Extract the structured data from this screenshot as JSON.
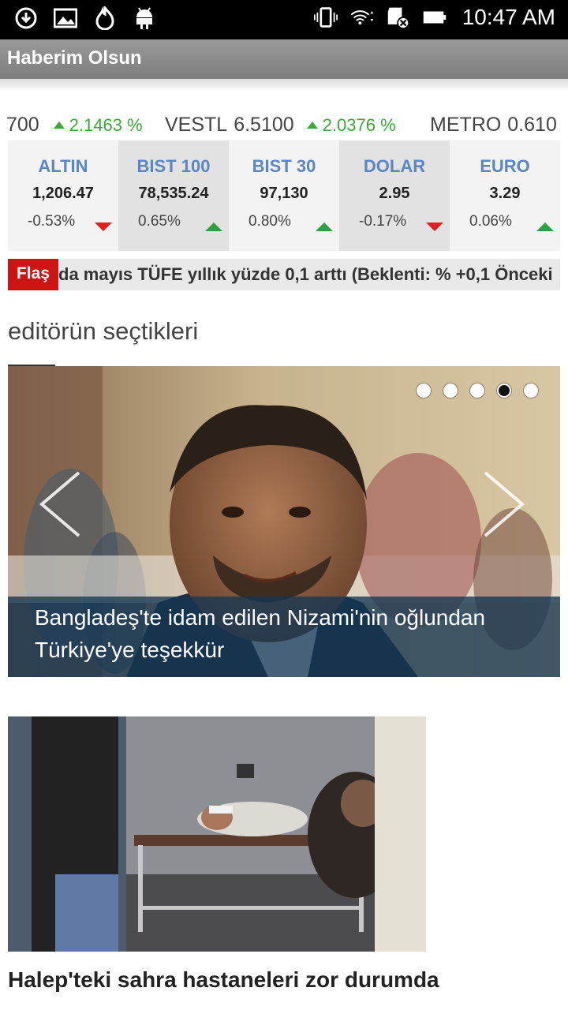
{
  "status_bar": {
    "time": "10:47 AM",
    "left_icons": [
      "download-icon",
      "image-icon",
      "flame-icon",
      "android-icon"
    ],
    "right_icons": [
      "vibrate-icon",
      "wifi-icon",
      "sd-card-icon",
      "battery-icon"
    ]
  },
  "app": {
    "title": "Haberim Olsun"
  },
  "ticker": {
    "items": [
      {
        "name": "",
        "price": "700",
        "change": "2.1463 %"
      },
      {
        "name": "VESTL",
        "price": "6.5100",
        "change": "2.0376 %"
      },
      {
        "name": "METRO",
        "price": "0.610",
        "change": ""
      }
    ]
  },
  "markets": [
    {
      "name": "ALTIN",
      "value": "1,206.47",
      "change": "-0.53%",
      "direction": "down"
    },
    {
      "name": "BIST 100",
      "value": "78,535.24",
      "change": "0.65%",
      "direction": "up"
    },
    {
      "name": "BIST 30",
      "value": "97,130",
      "change": "0.80%",
      "direction": "up"
    },
    {
      "name": "DOLAR",
      "value": "2.95",
      "change": "-0.17%",
      "direction": "down"
    },
    {
      "name": "EURO",
      "value": "3.29",
      "change": "0.06%",
      "direction": "up"
    }
  ],
  "flash": {
    "label": "Flaş",
    "text": "da mayıs TÜFE yıllık yüzde 0,1 arttı (Beklenti: % +0,1 Önceki"
  },
  "section": {
    "title": "editörün seçtikleri"
  },
  "slider": {
    "caption": "Bangladeş'te idam edilen Nizami'nin oğlundan Türkiye'ye teşekkür",
    "dot_count": 5,
    "active_dot": 4
  },
  "story": {
    "title": "Halep'teki sahra hastaneleri zor durumda"
  },
  "colors": {
    "up": "#3aaa35",
    "down": "#e0201e",
    "market_name": "#5b86c4",
    "flash": "#cc1414"
  }
}
